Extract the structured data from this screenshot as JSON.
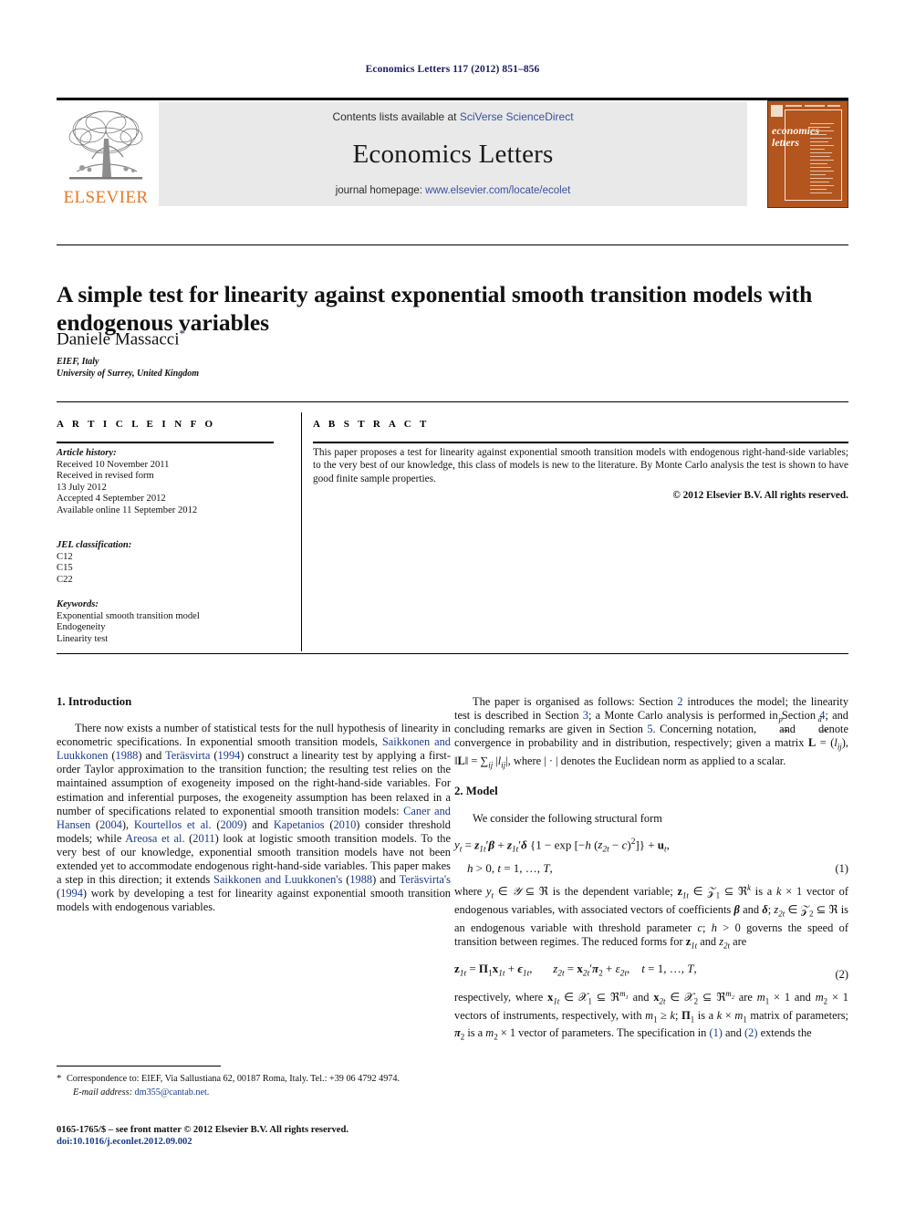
{
  "running_head": "Economics Letters 117 (2012) 851–856",
  "masthead": {
    "publisher_wordmark": "ELSEVIER",
    "contents_prefix": "Contents lists available at ",
    "contents_link": "SciVerse ScienceDirect",
    "journal_name": "Economics Letters",
    "homepage_prefix": "journal homepage: ",
    "homepage_link": "www.elsevier.com/locate/ecolet",
    "cover_title_line1": "economics",
    "cover_title_line2": "letters",
    "cover_color": "#b3551e",
    "band_color": "#e9e9e9",
    "link_color": "#3a4fa0",
    "elsevier_orange": "#e87722"
  },
  "article": {
    "title": "A simple test for linearity against exponential smooth transition models with endogenous variables",
    "author": "Daniele Massacci",
    "author_footnote_marker": "*",
    "affiliations": [
      "EIEF, Italy",
      "University of Surrey, United Kingdom"
    ]
  },
  "info": {
    "heading": "A R T I C L E   I N F O",
    "history_label": "Article history:",
    "history": [
      "Received 10 November 2011",
      "Received in revised form",
      "13 July 2012",
      "Accepted 4 September 2012",
      "Available online 11 September 2012"
    ],
    "jel_label": "JEL classification:",
    "jel": [
      "C12",
      "C15",
      "C22"
    ],
    "keywords_label": "Keywords:",
    "keywords": [
      "Exponential smooth transition model",
      "Endogeneity",
      "Linearity test"
    ]
  },
  "abstract": {
    "heading": "A B S T R A C T",
    "text": "This paper proposes a test for linearity against exponential smooth transition models with endogenous right-hand-side variables; to the very best of our knowledge, this class of models is new to the literature. By Monte Carlo analysis the test is shown to have good finite sample properties.",
    "copyright": "© 2012 Elsevier B.V. All rights reserved."
  },
  "sections": {
    "intro_heading": "1. Introduction",
    "model_heading": "2. Model",
    "intro_p1": {
      "t1": "There now exists a number of statistical tests for the null hypothesis of linearity in econometric specifications. In exponential smooth transition models, ",
      "r1": "Saikkonen and Luukkonen",
      "t2": " (",
      "r2": "1988",
      "t3": ") and ",
      "r3": "Teräsvirta",
      "t4": " (",
      "r4": "1994",
      "t5": ") construct a linearity test by applying a first-order Taylor approximation to the transition function; the resulting test relies on the maintained assumption of exogeneity imposed on the right-hand-side variables. For estimation and inferential purposes, the exogeneity assumption has been relaxed in a number of specifications related to exponential smooth transition models: ",
      "r5": "Caner and Hansen",
      "t6": " (",
      "r6": "2004",
      "t7": "), ",
      "r7": "Kourtellos et al.",
      "t8": " (",
      "r8": "2009",
      "t9": ") and ",
      "r9": "Kapetanios",
      "t10": " (",
      "r10": "2010",
      "t11": ") consider threshold models; while ",
      "r11": "Areosa et al.",
      "t12": " (",
      "r12": "2011",
      "t13": ") look at logistic smooth transition models. To the very best of our knowledge, exponential smooth transition models have not been extended yet to accommodate endogenous right-hand-side variables. This paper makes a step in this direction; it extends ",
      "r13": "Saikkonen and Luukkonen's",
      "t14": " (",
      "r14": "1988",
      "t15": ") and ",
      "r15": "Teräsvirta's",
      "t16": " (",
      "r16": "1994",
      "t17": ") work by developing a test for linearity against exponential smooth transition models with endogenous variables."
    },
    "right_p1": {
      "t1": "The paper is organised as follows: Section ",
      "r1": "2",
      "t2": " introduces the model; the linearity test is described in Section ",
      "r2": "3",
      "t3": "; a Monte Carlo analysis is performed in Section ",
      "r3": "4",
      "t4": "; and concluding remarks are given in Section ",
      "r4": "5",
      "t5": ". Concerning notation, "
    },
    "right_p1_tail": " and ",
    "right_p1_end": " denote convergence in probability and in distribution, respectively; given a matrix ",
    "model_lead": "We consider the following structural form",
    "eq1_number": "(1)",
    "eq2_number": "(2)",
    "after_eq1_a": "where ",
    "after_eq1_b": " is the dependent variable; ",
    "after_eq1_c": " is a ",
    "after_eq1_d": " vector of endogenous variables, with associated vectors of coefficients ",
    "after_eq1_e": " is an endogenous variable with threshold parameter ",
    "after_eq1_f": " governs the speed of transition between regimes. The reduced forms for ",
    "after_eq1_g": " are",
    "after_eq2_a": "respectively, where ",
    "after_eq2_b": " are ",
    "after_eq2_c": " vectors of instruments, respectively, with ",
    "after_eq2_d": " matrix of parameters; ",
    "after_eq2_e": " vector of parameters. The specification in ",
    "after_eq2_f": " and ",
    "after_eq2_g": " extends the"
  },
  "footer": {
    "correspondence": "Correspondence to: EIEF, Via Sallustiana 62, 00187 Roma, Italy. Tel.: +39 06 4792 4974.",
    "email_label": "E-mail address:",
    "email": "dm355@cantab.net.",
    "issn_line": "0165-1765/$ – see front matter © 2012 Elsevier B.V. All rights reserved.",
    "doi_line": "doi:10.1016/j.econlet.2012.09.002"
  }
}
